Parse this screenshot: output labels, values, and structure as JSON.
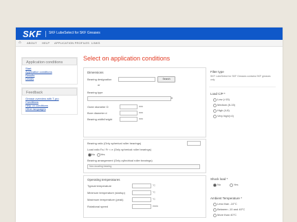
{
  "header": {
    "logo": "SKF",
    "app_title": "SKF LubeSelect for SKF Greases"
  },
  "nav": {
    "home_icon": "home-icon",
    "items": [
      "ABOUT",
      "HELP",
      "APPLICATION PROFILES",
      "LINKS"
    ]
  },
  "sidebar": {
    "app_conditions": "Application conditions",
    "links": [
      "Start",
      "Application conditions",
      "Results",
      "Details"
    ],
    "feedback": "Feedback",
    "feedback_links": [
      "Grease overview with T-pro",
      "Conditions",
      "Help on conditions",
      "Other languages"
    ]
  },
  "main": {
    "title": "Select on application conditions",
    "dimensions": {
      "heading": "Dimensions",
      "bearing_designation_label": "Bearing designation",
      "bearing_designation_value": "",
      "search_label": "Search",
      "or": "or",
      "bearing_type_label": "Bearing type",
      "bearing_type_value": "",
      "outer_diameter_label": "Outer diameter D",
      "bore_diameter_label": "Bore diameter d",
      "width_label": "Bearing width/height",
      "unit_mm": "mm"
    },
    "lubrication": {
      "bearing_ratio_label": "Bearing ratio (Only spherical roller bearings)",
      "load_ratio_label": "Load ratio Fa / Fr < e (Only spherical roller bearings)",
      "load_ratio_options": [
        "No",
        "Yes"
      ],
      "bearing_arrangement_label": "Bearing arrangement (Only cylindrical roller bearings)",
      "bearing_arrangement_value": "Non-locating bearing"
    },
    "operating": {
      "heading": "Operating temperatures",
      "typical_temp_label": "Typical temperature",
      "min_temp_label": "Minimum temperature (startup)",
      "max_temp_label": "Maximum temperature (peak)",
      "speed_label": "Rotational speed",
      "unit_c": "°C",
      "unit_rpm": "r/min"
    }
  },
  "right": {
    "filter_type": {
      "heading": "Filter type",
      "text": "SKF LubeSelect for SKF Greases contains SKF greases only"
    },
    "load": {
      "heading": "Load C/P *",
      "options": [
        "Low (>15)",
        "Medium (8-15)",
        "High (4-8)",
        "Very high(<4)"
      ]
    },
    "shock_load": {
      "heading": "Shock load *",
      "options": [
        "No",
        "Yes"
      ]
    },
    "ambient": {
      "heading": "Ambient Temperature *",
      "options": [
        "Less than -10°C",
        "Between -10 and 40°C",
        "More than 40°C"
      ]
    }
  }
}
